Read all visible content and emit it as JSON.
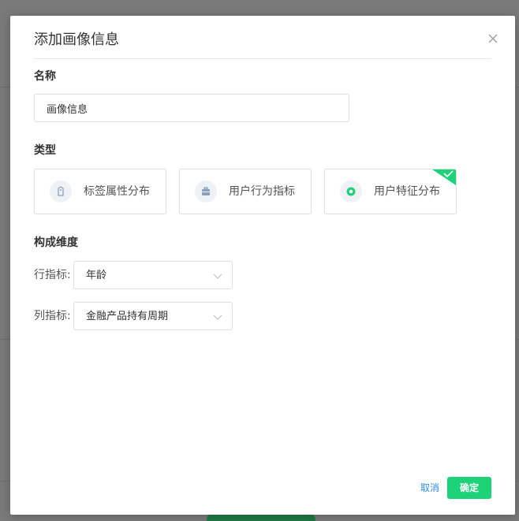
{
  "dialog": {
    "title": "添加画像信息",
    "close_icon": "close-icon"
  },
  "name_section": {
    "label": "名称",
    "input_value": "画像信息"
  },
  "type_section": {
    "label": "类型",
    "options": [
      {
        "label": "标签属性分布",
        "icon": "tag-icon",
        "selected": false
      },
      {
        "label": "用户行为指标",
        "icon": "briefcase-icon",
        "selected": false
      },
      {
        "label": "用户特征分布",
        "icon": "target-icon",
        "selected": true
      }
    ]
  },
  "dimension_section": {
    "label": "构成维度",
    "row_label": "行指标:",
    "row_value": "年龄",
    "col_label": "列指标:",
    "col_value": "金融产品持有周期"
  },
  "footer": {
    "cancel_label": "取消",
    "confirm_label": "确定"
  },
  "colors": {
    "accent_green": "#1ed27a",
    "link_blue": "#2d8cf0",
    "icon_blue": "#8aa0bd",
    "icon_green": "#1ed27a"
  }
}
